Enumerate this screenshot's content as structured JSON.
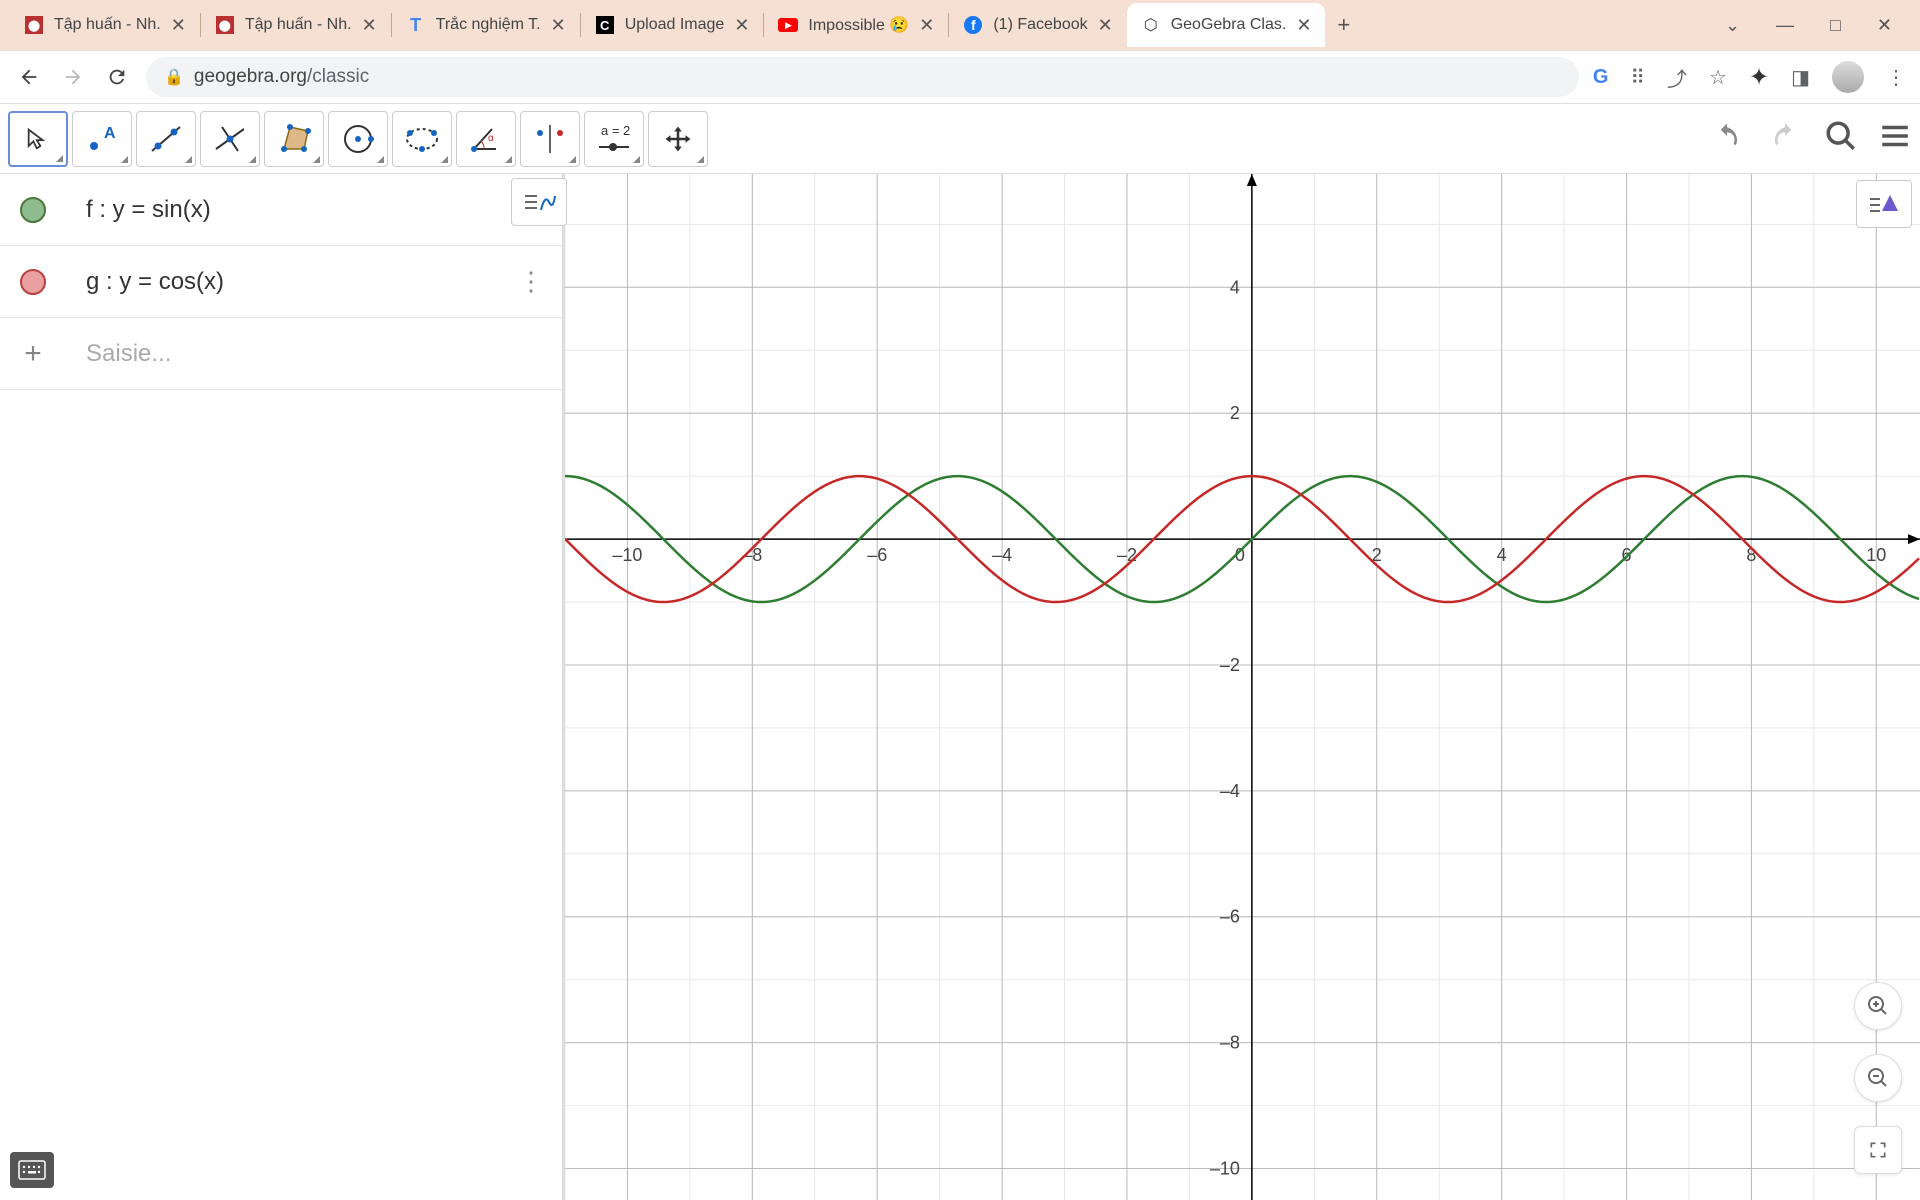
{
  "browser": {
    "tabs": [
      {
        "title": "Tập huấn - Nh.",
        "icon": "red-box"
      },
      {
        "title": "Tập huấn - Nh.",
        "icon": "red-box"
      },
      {
        "title": "Trắc nghiệm T.",
        "icon": "T"
      },
      {
        "title": "Upload Image",
        "icon": "black-C"
      },
      {
        "title": "Impossible 😢",
        "icon": "youtube"
      },
      {
        "title": "(1) Facebook",
        "icon": "facebook"
      },
      {
        "title": "GeoGebra Clas.",
        "icon": "geogebra",
        "active": true
      }
    ],
    "url_host": "geogebra.org",
    "url_path": "/classic"
  },
  "toolbar": {
    "slider_label": "a = 2"
  },
  "algebra": {
    "rows": [
      {
        "color": "green",
        "expr": "f : y = sin(x)"
      },
      {
        "color": "red",
        "expr": "g : y = cos(x)"
      }
    ],
    "input_placeholder": "Saisie..."
  },
  "chart_data": {
    "type": "line",
    "x": [
      -11,
      -10.5,
      -10,
      -9.5,
      -9,
      -8.5,
      -8,
      -7.5,
      -7,
      -6.5,
      -6,
      -5.5,
      -5,
      -4.5,
      -4,
      -3.5,
      -3,
      -2.5,
      -2,
      -1.5,
      -1,
      -0.5,
      0,
      0.5,
      1,
      1.5,
      2,
      2.5,
      3,
      3.5,
      4,
      4.5,
      5,
      5.5,
      6,
      6.5,
      7,
      7.5,
      8,
      8.5,
      9,
      9.5,
      10,
      10.5,
      11
    ],
    "series": [
      {
        "name": "f : y = sin(x)",
        "color": "#2e7d32",
        "func": "sin"
      },
      {
        "name": "g : y = cos(x)",
        "color": "#c62828",
        "func": "cos"
      }
    ],
    "x_ticks": [
      -10,
      -8,
      -6,
      -4,
      -2,
      0,
      2,
      4,
      6,
      8,
      10
    ],
    "y_ticks": [
      -10,
      -8,
      -6,
      -4,
      -2,
      2,
      4
    ],
    "xlim": [
      -11,
      10.7
    ],
    "ylim": [
      -10.5,
      5.8
    ],
    "origin_label": "0",
    "minor_grid": 1,
    "major_grid": 2
  }
}
